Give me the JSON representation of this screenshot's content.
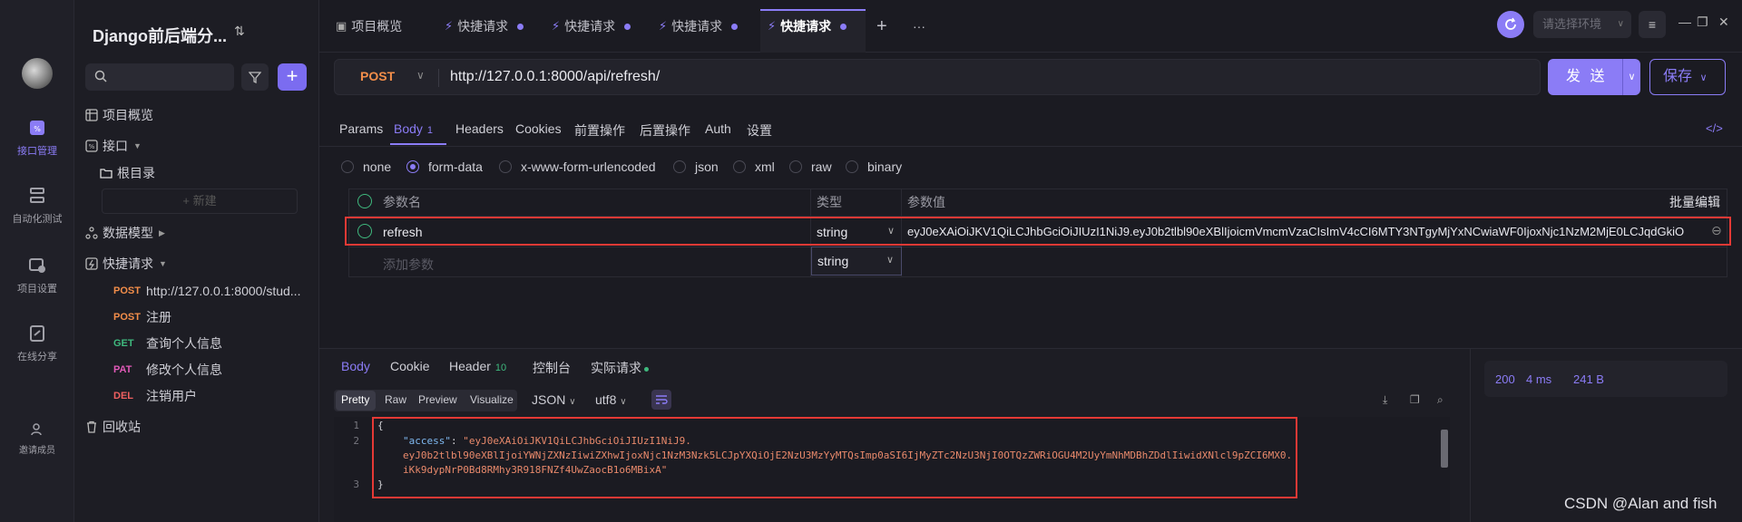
{
  "rail": {
    "items": [
      {
        "label": "接口管理",
        "icon": "api-icon",
        "active": true
      },
      {
        "label": "自动化测试",
        "icon": "automation-icon"
      },
      {
        "label": "项目设置",
        "icon": "settings-icon"
      },
      {
        "label": "在线分享",
        "icon": "share-icon"
      },
      {
        "label": "邀请成员",
        "icon": "invite-member-icon"
      }
    ]
  },
  "sidebar": {
    "project_title": "Django前后端分...",
    "new_label": "+ 新建",
    "tree": {
      "overview": "项目概览",
      "api": "接口",
      "root": "根目录",
      "models": "数据模型",
      "quick": "快捷请求",
      "trash": "回收站"
    },
    "requests": [
      {
        "method": "POST",
        "label": "http://127.0.0.1:8000/stud..."
      },
      {
        "method": "POST",
        "label": "注册"
      },
      {
        "method": "GET",
        "label": "查询个人信息"
      },
      {
        "method": "PAT",
        "label": "修改个人信息"
      },
      {
        "method": "DEL",
        "label": "注销用户"
      }
    ]
  },
  "tabs": {
    "items": [
      "项目概览",
      "快捷请求",
      "快捷请求",
      "快捷请求",
      "快捷请求"
    ],
    "add": "+",
    "more": "···"
  },
  "env": {
    "placeholder": "请选择环境"
  },
  "request": {
    "method": "POST",
    "url": "http://127.0.0.1:8000/api/refresh/",
    "send": "发 送",
    "save": "保存"
  },
  "req_tabs": {
    "params": "Params",
    "body": "Body",
    "body_count": "1",
    "headers": "Headers",
    "cookies": "Cookies",
    "pre": "前置操作",
    "post": "后置操作",
    "auth": "Auth",
    "settings": "设置"
  },
  "body_types": [
    "none",
    "form-data",
    "x-www-form-urlencoded",
    "json",
    "xml",
    "raw",
    "binary"
  ],
  "params_table": {
    "col_name": "参数名",
    "col_type": "类型",
    "col_value": "参数值",
    "bulk_edit": "批量编辑",
    "row": {
      "name": "refresh",
      "type": "string",
      "value": "eyJ0eXAiOiJKV1QiLCJhbGciOiJIUzI1NiJ9.eyJ0b2tlbl90eXBlIjoicmVmcmVzaCIsImV4cCI6MTY3NTgyMjYxNCwiaWF0IjoxNjc1NzM2MjE0LCJqdGkiO"
    },
    "add_placeholder": "添加参数",
    "add_type": "string"
  },
  "response": {
    "tabs": {
      "body": "Body",
      "cookie": "Cookie",
      "header": "Header",
      "header_count": "10",
      "console": "控制台",
      "actual": "实际请求"
    },
    "formats": [
      "Pretty",
      "Raw",
      "Preview",
      "Visualize"
    ],
    "lang": "JSON",
    "encoding": "utf8",
    "status": "200",
    "time": "4 ms",
    "size": "241 B",
    "lines": [
      "1",
      "2",
      "",
      "",
      "3"
    ],
    "code": {
      "open": "{",
      "key": "\"access\"",
      "colon": ": ",
      "v1": "\"eyJ0eXAiOiJKV1QiLCJhbGciOiJIUzI1NiJ9.",
      "v2": "eyJ0b2tlbl90eXBlIjoiYWNjZXNzIiwiZXhwIjoxNjc1NzM3Nzk5LCJpYXQiOjE2NzU3MzYyMTQsImp0aSI6IjMyZTc2NzU3NjI0OTQzZWRiOGU4M2UyYmNhMDBhZDdlIiwidXNlcl9pZCI6MX0.",
      "v3": "iKk9dypNrP0Bd8RMhy3R918FNZf4UwZaocB1o6MBixA\"",
      "close": "}"
    }
  },
  "watermark": "CSDN @Alan and fish",
  "colors": {
    "accent": "#8b7cf6",
    "post": "#f38e4a",
    "get": "#3fb97e",
    "highlight": "#e53935"
  }
}
